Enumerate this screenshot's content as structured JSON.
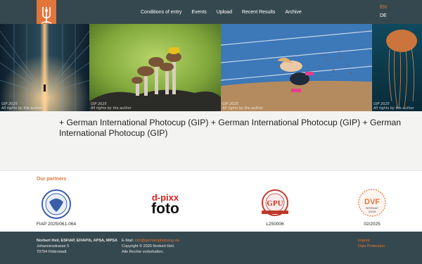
{
  "nav": {
    "items": [
      "Conditions of entry",
      "Events",
      "Upload",
      "Recent Results",
      "Archive"
    ],
    "lang_active": "EN",
    "lang_other": "DE"
  },
  "gallery": {
    "captions": [
      [
        "GIP 2025",
        "All rights by the author"
      ],
      [
        "GIP 2025",
        "All rights by the author"
      ],
      [
        "GIP 2025",
        "All rights by the author"
      ],
      [
        "GIP 2025",
        "All rights by the author"
      ]
    ]
  },
  "main": {
    "title": "+ German International Photocup (GIP) + German International Photocup (GIP) + German International Photocup (GIP)"
  },
  "partners": {
    "heading": "Our partners",
    "items": [
      {
        "label": "FIAP 2025/061-064"
      },
      {
        "label": ""
      },
      {
        "label": "L250006"
      },
      {
        "label": "02/2025"
      }
    ],
    "dpixx_top": "d-pixx",
    "dpixx_bottom": "foto",
    "gpu_text": "GPU",
    "dvf_text": "DVF",
    "dvf_sub": "PATRONAT",
    "dvf_year": "2/2025"
  },
  "footer": {
    "name": "Norbert Heil, ESFIAP, EFIAP/b, APSA, MPSA",
    "street": "Johannesstrasse 5",
    "city": "70794 Filderstadt",
    "email_label": "E-Mail:",
    "email": "info@germanphotocup.de",
    "copyright": "Copyright © 2025 Norbert Heil.",
    "rights": "Alle Rechte vorbehalten.",
    "imprint": "Imprint",
    "privacy": "Data Protection"
  },
  "colors": {
    "accent": "#e3753a",
    "bar": "#36484f"
  }
}
